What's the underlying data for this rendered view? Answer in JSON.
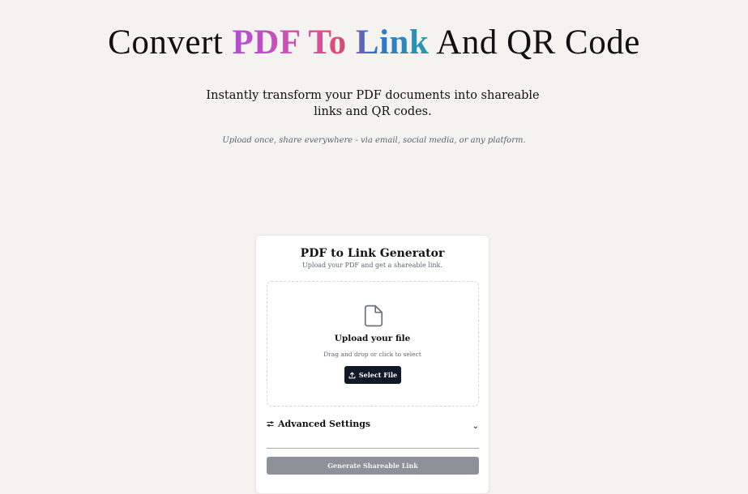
{
  "hero": {
    "title_prefix": "Convert",
    "title_highlight": "PDF To Link",
    "title_suffix": "And QR Code",
    "subtitle": "Instantly transform your PDF documents into shareable links and QR codes.",
    "tagline": "Upload once, share everywhere - via email, social media, or any platform."
  },
  "card": {
    "title": "PDF to Link Generator",
    "subtitle": "Upload your PDF and get a shareable link.",
    "dropzone": {
      "icon": "file-icon",
      "title": "Upload your file",
      "hint": "Drag and drop or click to select",
      "button_label": "Select File",
      "button_icon": "upload-icon"
    },
    "advanced": {
      "icon": "sliders-icon",
      "label": "Advanced Settings",
      "chevron": "chevron-down-icon"
    },
    "generate_label": "Generate Shareable Link"
  },
  "colors": {
    "background": "#f4f3f0",
    "gradient_start": "#b24fd6",
    "gradient_end": "#2a9aa8",
    "primary_button": "#111827",
    "disabled_button": "#8d9199"
  }
}
